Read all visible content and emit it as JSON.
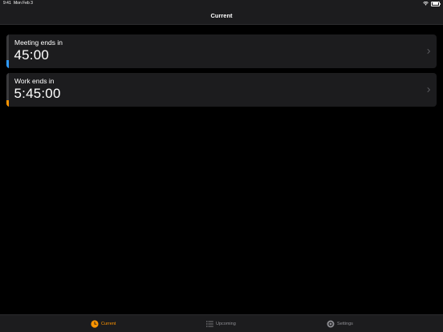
{
  "status_bar": {
    "time": "9:41",
    "date": "Mon Feb 3"
  },
  "nav": {
    "title": "Current"
  },
  "timers": [
    {
      "label": "Meeting ends in",
      "time": "45:00",
      "accent_color": "#2f9bff",
      "progress": 0.25
    },
    {
      "label": "Work ends in",
      "time": "5:45:00",
      "accent_color": "#ff9500",
      "progress": 0.2
    }
  ],
  "tabs": [
    {
      "label": "Current",
      "icon": "clock-icon",
      "selected": true
    },
    {
      "label": "Upcoming",
      "icon": "list-icon",
      "selected": false
    },
    {
      "label": "Settings",
      "icon": "gear-icon",
      "selected": false
    }
  ],
  "colors": {
    "background": "#000000",
    "surface": "#1c1c1e",
    "tab_active": "#ff9500",
    "tab_inactive": "#8e8e93"
  }
}
